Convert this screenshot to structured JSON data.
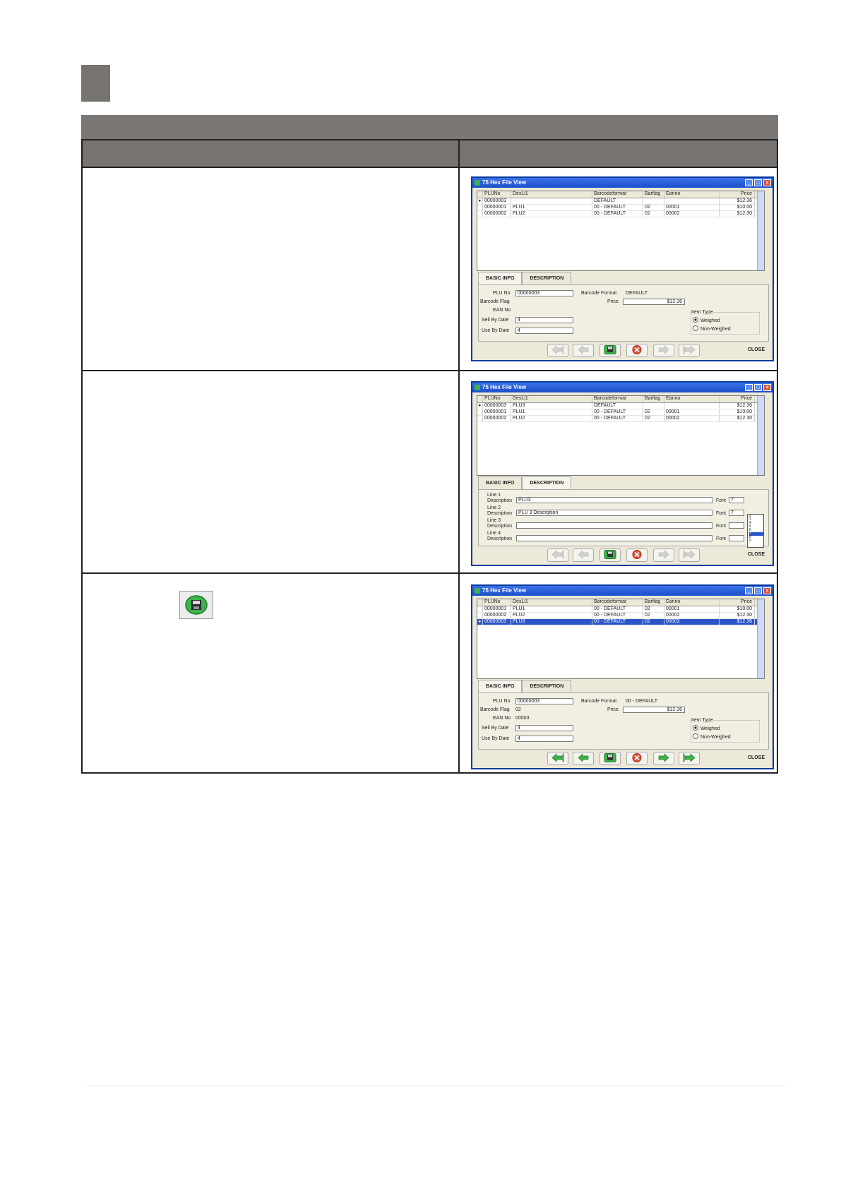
{
  "windows": [
    {
      "title": "75 Hex File View",
      "columns": [
        "PLUNo",
        "DesLi1",
        "Barcodeformat",
        "Barflag",
        "Eanno",
        "Price"
      ],
      "rows": [
        {
          "cells": [
            "00000003",
            "",
            "DEFAULT",
            "",
            "",
            "$12.36"
          ],
          "selected": false
        },
        {
          "cells": [
            "00000001",
            "PLU1",
            "00 - DEFAULT",
            "02",
            "00001",
            "$10.00"
          ],
          "selected": false
        },
        {
          "cells": [
            "00000002",
            "PLU2",
            "00 - DEFAULT",
            "02",
            "00002",
            "$12.30"
          ],
          "selected": false
        }
      ],
      "tabs": [
        "BASIC INFO",
        "DESCRIPTION"
      ],
      "active_tab": "BASIC INFO",
      "labels": {
        "plu_no": "PLU No",
        "barcode_flag": "Barcode Flag",
        "ean_no": "EAN No",
        "sell_by": "Sell By Date",
        "use_by": "Use By Date",
        "barcode_format": "Barcode Format",
        "price": "Price",
        "item_type": "Item Type",
        "weighed": "Weighed",
        "non_weighed": "Non-Weighed"
      },
      "values": {
        "plu_no": "00000003",
        "barcode_flag": "",
        "ean_no": "",
        "sell_by": "4",
        "use_by": "4",
        "barcode_format": "DEFAULT",
        "price": "$12.36"
      },
      "close_label": "CLOSE"
    },
    {
      "title": "75 Hex File View",
      "columns": [
        "PLUNo",
        "DesLi1",
        "Barcodeformat",
        "Barflag",
        "Eanno",
        "Price"
      ],
      "rows": [
        {
          "cells": [
            "00000003",
            "PLU3",
            "DEFAULT",
            "",
            "",
            "$12.36"
          ],
          "selected": false
        },
        {
          "cells": [
            "00000001",
            "PLU1",
            "00 - DEFAULT",
            "02",
            "00001",
            "$10.00"
          ],
          "selected": false
        },
        {
          "cells": [
            "00000002",
            "PLU2",
            "00 - DEFAULT",
            "02",
            "00002",
            "$12.30"
          ],
          "selected": false
        }
      ],
      "tabs": [
        "BASIC INFO",
        "DESCRIPTION"
      ],
      "active_tab": "DESCRIPTION",
      "description_lines": [
        {
          "label_a": "Line 1",
          "label_b": "Description",
          "value": "PLU3",
          "font": "7"
        },
        {
          "label_a": "Line 2",
          "label_b": "Description",
          "value": "PLU 3 Description",
          "font": "7"
        },
        {
          "label_a": "Line 3",
          "label_b": "Description",
          "value": "",
          "font": ""
        },
        {
          "label_a": "Line 4",
          "label_b": "Description",
          "value": "",
          "font": ""
        }
      ],
      "font_label": "Font",
      "font_options": [
        "2",
        "3",
        "4",
        "5",
        "6",
        "7",
        "8",
        "9"
      ],
      "font_highlight": "7",
      "close_label": "CLOSE"
    },
    {
      "title": "75 Hex File View",
      "columns": [
        "PLUNo",
        "DesLi1",
        "Barcodeformat",
        "Barflag",
        "Eanno",
        "Price"
      ],
      "rows": [
        {
          "cells": [
            "00000001",
            "PLU1",
            "00 - DEFAULT",
            "02",
            "00001",
            "$10.00"
          ],
          "selected": false
        },
        {
          "cells": [
            "00000002",
            "PLU2",
            "00 - DEFAULT",
            "02",
            "00002",
            "$12.30"
          ],
          "selected": false
        },
        {
          "cells": [
            "00000003",
            "PLU3",
            "00 - DEFAULT",
            "02",
            "00003",
            "$12.36"
          ],
          "selected": true
        }
      ],
      "tabs": [
        "BASIC INFO",
        "DESCRIPTION"
      ],
      "active_tab": "BASIC INFO",
      "labels": {
        "plu_no": "PLU No",
        "barcode_flag": "Barcode Flag",
        "ean_no": "EAN No",
        "sell_by": "Sell By Date",
        "use_by": "Use By Date",
        "barcode_format": "Barcode Format",
        "price": "Price",
        "item_type": "Item Type",
        "weighed": "Weighed",
        "non_weighed": "Non-Weighed"
      },
      "values": {
        "plu_no": "00000003",
        "barcode_flag": "02",
        "ean_no": "00003",
        "sell_by": "4",
        "use_by": "4",
        "barcode_format": "00 - DEFAULT",
        "price": "$12.36"
      },
      "close_label": "CLOSE"
    }
  ],
  "icons": {
    "save": "save-disk-icon",
    "delete": "delete-x-icon",
    "first": "first-arrow-icon",
    "prev": "prev-arrow-icon",
    "next": "next-arrow-icon",
    "last": "last-arrow-icon"
  },
  "colors": {
    "header_gray": "#777370",
    "title_blue": "#1d4fcc",
    "selection_blue": "#2a54c8",
    "button_green": "#3cb34a",
    "button_red": "#e0533b"
  }
}
